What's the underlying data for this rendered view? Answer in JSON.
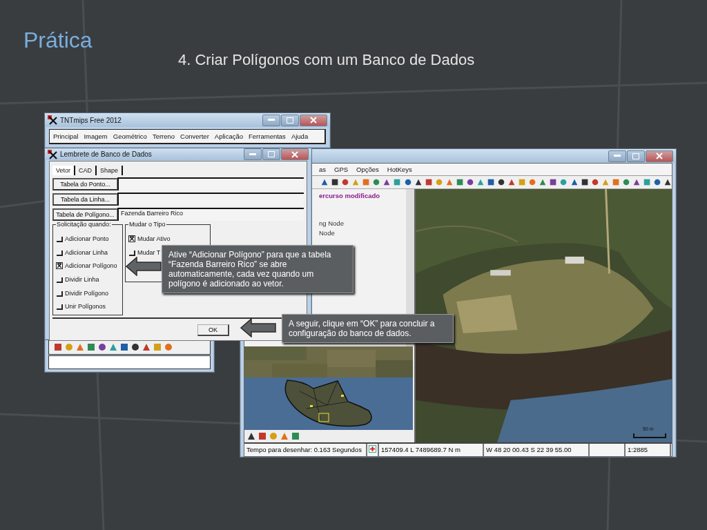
{
  "slide": {
    "title": "Prática",
    "subtitle": "4. Criar Polígonos com um Banco de Dados"
  },
  "main_window": {
    "title": "TNTmips Free 2012",
    "menu": [
      "Principal",
      "Imagem",
      "Geométrico",
      "Terreno",
      "Converter",
      "Aplicação",
      "Ferramentas",
      "Ajuda"
    ]
  },
  "view_window": {
    "menu": [
      "as",
      "GPS",
      "Opções",
      "HotKeys"
    ],
    "legend": [
      {
        "label": "ercurso modificado",
        "kind": "heading"
      },
      {
        "label": "ng Node",
        "kind": "item"
      },
      {
        "label": "Node",
        "kind": "item"
      }
    ],
    "scale_label": "50 m",
    "status_bar": [
      "Tempo para desenhar: 0.163 Segundos",
      "157409.4 L  7489689.7 N m",
      "W 48 20 00.43  S 22 39 55.00",
      "1:2885"
    ]
  },
  "dialog": {
    "title": "Lembrete de Banco de Dados",
    "tabs": [
      {
        "label": "Vetor",
        "selected": true
      },
      {
        "label": "CAD",
        "selected": false
      },
      {
        "label": "Shape",
        "selected": false
      }
    ],
    "tables": [
      {
        "button": "Tabela do Ponto..."
      },
      {
        "button": "Tabela da Linha..."
      },
      {
        "button": "Tabela de Polígono...",
        "value": "Fazenda Barreiro Rico"
      }
    ],
    "solicit_group": {
      "title": "Solicitação quando:",
      "options": [
        {
          "label": "Adicionar Ponto",
          "checked": false
        },
        {
          "label": "Adicionar Linha",
          "checked": false
        },
        {
          "label": "Adicionar Polígono",
          "checked": true
        },
        {
          "label": "Dividir Linha",
          "checked": false
        },
        {
          "label": "Dividir Polígono",
          "checked": false
        },
        {
          "label": "Unir Polígonos",
          "checked": false
        }
      ]
    },
    "type_group": {
      "title": "Mudar o Tipo",
      "options": [
        {
          "label": "Mudar Ativo",
          "checked": true
        },
        {
          "label": "Mudar T",
          "checked": false
        }
      ]
    },
    "ok_button": "OK"
  },
  "callouts": [
    {
      "text": "Ative “Adicionar Polígono” para que a tabela “Fazenda Barreiro Rico” se abre automaticamente, cada vez quando um polígono é adicionado ao vetor."
    },
    {
      "text": "A seguir, clique em “OK” para concluir a configuração do banco de dados."
    }
  ]
}
